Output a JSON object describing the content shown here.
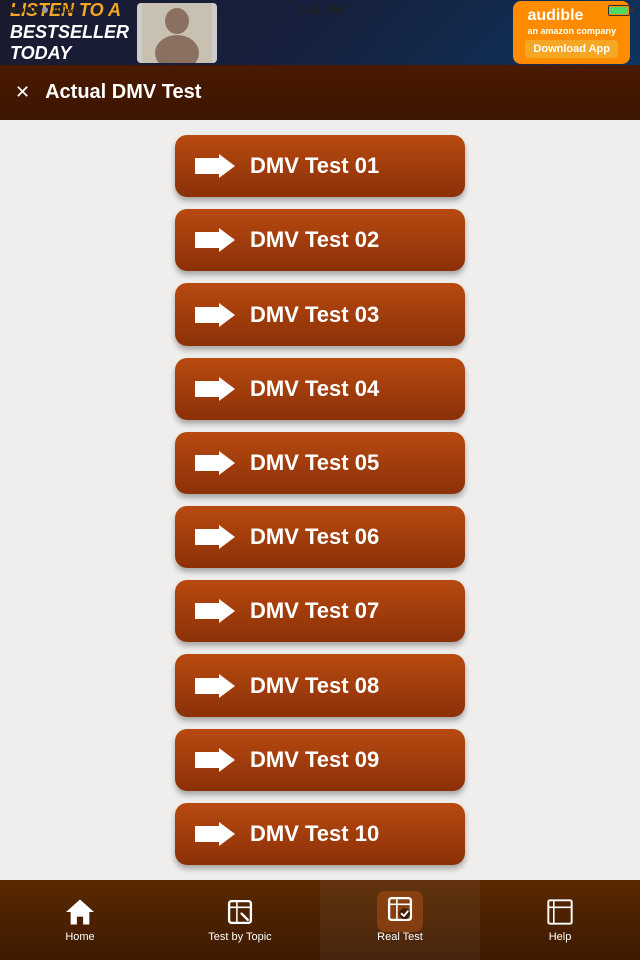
{
  "status_bar": {
    "dots": [
      true,
      true,
      true,
      true,
      false
    ],
    "carrier": "AT&T",
    "time": "3:41 PM",
    "battery_pct": 85
  },
  "ad_banner": {
    "text": "LISTEN TO A BESTSELLER TODAY",
    "logo": "audible",
    "button": "Download App"
  },
  "header": {
    "close_label": "✕",
    "title": "Actual DMV Test"
  },
  "tests": [
    {
      "label": "DMV Test 01"
    },
    {
      "label": "DMV Test 02"
    },
    {
      "label": "DMV Test 03"
    },
    {
      "label": "DMV Test 04"
    },
    {
      "label": "DMV Test 05"
    },
    {
      "label": "DMV Test 06"
    },
    {
      "label": "DMV Test 07"
    },
    {
      "label": "DMV Test 08"
    },
    {
      "label": "DMV Test 09"
    },
    {
      "label": "DMV Test 10"
    }
  ],
  "tab_bar": {
    "items": [
      {
        "id": "home",
        "label": "Home",
        "active": false
      },
      {
        "id": "test-by-topic",
        "label": "Test by Topic",
        "active": false
      },
      {
        "id": "real-test",
        "label": "Real Test",
        "active": true
      },
      {
        "id": "help",
        "label": "Help",
        "active": false
      }
    ]
  }
}
